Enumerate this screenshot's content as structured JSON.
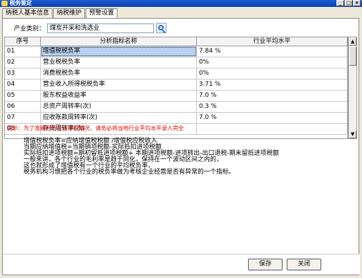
{
  "window": {
    "title": "税务鉴定",
    "minimize": "_",
    "maximize": "□",
    "close": "×"
  },
  "tabs": [
    {
      "label": "纳税人基本信息"
    },
    {
      "label": "纳税维护"
    },
    {
      "label": "预警设置"
    }
  ],
  "industry": {
    "label": "产业类别：",
    "value": "煤炭开采和洗选业"
  },
  "table": {
    "headers": [
      "序号",
      "分析指标名称",
      "行业平均水平"
    ],
    "rows": [
      {
        "seq": "01",
        "name": "增值税税负率",
        "avg": "7.84 %"
      },
      {
        "seq": "02",
        "name": "营业税税负率",
        "avg": "0%"
      },
      {
        "seq": "03",
        "name": "消费税税负率",
        "avg": "0%"
      },
      {
        "seq": "04",
        "name": "营业收入所得税税负率",
        "avg": "3.71 %"
      },
      {
        "seq": "05",
        "name": "股东权益收益率",
        "avg": "7.0 %"
      },
      {
        "seq": "06",
        "name": "总资产周转率(次)",
        "avg": "0.3 %"
      },
      {
        "seq": "07",
        "name": "应收账款周转率(次)",
        "avg": "7.0 %"
      },
      {
        "seq": "08",
        "name": "存货周转率(次)",
        "avg": ""
      }
    ]
  },
  "tip": "提示：为了准确分析企业涉税情况，请务必将当地行业平均水平录入完全",
  "explanation": [
    "增值税税负率=应纳增值税税额 /增值税应税收入",
    "当期应纳增值税=当期销项税额-实际抵扣进项税额",
    "实际抵扣进项税额=期初留抵进项税额+ 本期进项税额-进项转出-出口退税-期末留抵进项税额",
    "一般来讲，各个行业的毛利率是趋于同化，保持在一个波动区间之内的，",
    "这也就形成了增值税有一个行业的平均税负率，",
    "税务机构习惯把各个行业的税负率做为考核企业经营是否有异常的一个指标。"
  ],
  "buttons": {
    "save": "保存",
    "close": "关闭"
  }
}
